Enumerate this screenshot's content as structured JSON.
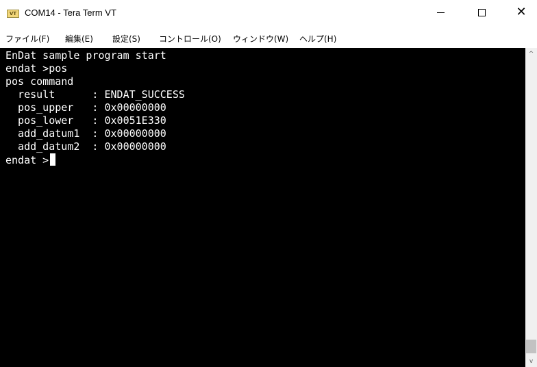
{
  "window": {
    "title": "COM14 - Tera Term VT",
    "icon_label": "VT",
    "minimize_glyph": "",
    "maximize_glyph": "",
    "close_glyph": "✕"
  },
  "menu": {
    "items": [
      {
        "label": "ファイル(F)"
      },
      {
        "label": "編集(E)"
      },
      {
        "label": "設定(S)"
      },
      {
        "label": "コントロール(O)"
      },
      {
        "label": "ウィンドウ(W)"
      },
      {
        "label": "ヘルプ(H)"
      }
    ]
  },
  "terminal": {
    "lines": [
      "EnDat sample program start",
      "endat >pos",
      "pos command",
      "  result      : ENDAT_SUCCESS",
      "  pos_upper   : 0x00000000",
      "  pos_lower   : 0x0051E330",
      "  add_datum1  : 0x00000000",
      "  add_datum2  : 0x00000000",
      "endat >"
    ],
    "colors": {
      "background": "#000000",
      "foreground": "#ffffff"
    }
  },
  "scrollbar": {
    "up_arrow": "^",
    "down_arrow": "v"
  }
}
